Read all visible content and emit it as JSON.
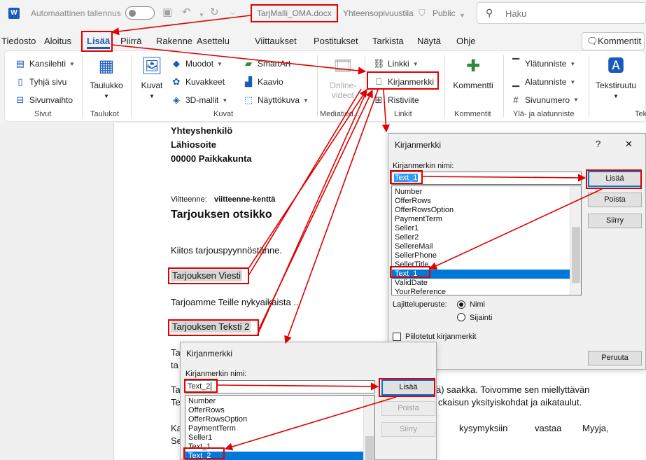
{
  "titlebar": {
    "autosave_label": "Automaattinen tallennus",
    "filename": "TarjMalli_OMA.docx",
    "compat": "Yhteensopivuustila",
    "sensitivity": "Public",
    "search_placeholder": "Haku"
  },
  "menu": [
    "Tiedosto",
    "Aloitus",
    "Lisää",
    "Piirrä",
    "Rakenne",
    "Asettelu",
    "Viittaukset",
    "Postitukset",
    "Tarkista",
    "Näytä",
    "Ohje"
  ],
  "comments_button": "Kommentit",
  "ribbon": {
    "sivut": {
      "items": [
        "Kansilehti",
        "Tyhjä sivu",
        "Sivunvaihto"
      ],
      "label": "Sivut"
    },
    "taulukot": {
      "button": "Taulukko",
      "label": "Taulukot"
    },
    "kuvat": {
      "button": "Kuvat",
      "items": [
        "Muodot",
        "Kuvakkeet",
        "3D-mallit",
        "SmartArt",
        "Kaavio",
        "Näyttökuva"
      ],
      "label": "Kuvat"
    },
    "media": {
      "line1": "Online-",
      "line2": "videot",
      "label": "Mediatied..."
    },
    "linkit": {
      "items": [
        "Linkki",
        "Kirjanmerkki",
        "Ristiviite"
      ],
      "label": "Linkit"
    },
    "kommentit": {
      "button": "Kommentti",
      "label": "Kommentit"
    },
    "ylaala": {
      "items": [
        "Ylätunniste",
        "Alatunniste",
        "Sivunumero"
      ],
      "label": "Ylä- ja alatunniste"
    },
    "teksti": {
      "button": "Tekstiruutu",
      "label": "Tek"
    }
  },
  "document": {
    "lines": [
      "Yhteyshenkilö",
      "Lähiosoite",
      "00000 Paikkakunta"
    ],
    "ref_label": "Viitteenne:",
    "ref_value": "viitteenne-kenttä",
    "heading": "Tarjouksen otsikko",
    "thanks": "Kiitos tarjouspyynnöstänne.",
    "field1": "Tarjouksen Viesti",
    "offer": "Tarjoamme Teille nykyaikaista ...",
    "field2": "Tarjouksen Teksti 2",
    "frag_ta1": "Ta",
    "frag_ta2": "ta",
    "frag_ta3": "Ta",
    "frag_te": "Te",
    "frag_ka": "Ka",
    "frag_se": "Se",
    "right1": "ä)  saakka.  Toivomme  sen  miellyttävän",
    "right2": "ckaisun yksityiskohdat ja aikataulut.",
    "right3_a": "kysymyksiin",
    "right3_b": "vastaa",
    "right3_c": "Myyja,"
  },
  "dialog1": {
    "title": "Kirjanmerkki",
    "help": "?",
    "close": "✕",
    "name_label": "Kirjanmerkin nimi:",
    "name_value": "Text_1",
    "items": [
      "Number",
      "OfferRows",
      "OfferRowsOption",
      "PaymentTerm",
      "Seller1",
      "Seller2",
      "SellereMail",
      "SellerPhone",
      "SellerTitle",
      "Text_1",
      "ValidDate",
      "YourReference"
    ],
    "selected": "Text_1",
    "btn_add": "Lisää",
    "btn_delete": "Poista",
    "btn_goto": "Siirry",
    "sort_label": "Lajitteluperuste:",
    "sort_name": "Nimi",
    "sort_location": "Sijainti",
    "hidden_label": "Piilotetut kirjanmerkit",
    "btn_cancel": "Peruuta"
  },
  "dialog2": {
    "title": "Kirjanmerkki",
    "name_label": "Kirjanmerkin nimi:",
    "name_value": "Text_2",
    "items": [
      "Number",
      "OfferRows",
      "OfferRowsOption",
      "PaymentTerm",
      "Seller1",
      "Text_1",
      "Text_2"
    ],
    "selected": "Text_2",
    "btn_add": "Lisää",
    "btn_delete": "Poista",
    "btn_goto": "Siirry"
  },
  "colors": {
    "accent": "#185abd",
    "annotation": "#e00000",
    "selection": "#0078d7"
  }
}
